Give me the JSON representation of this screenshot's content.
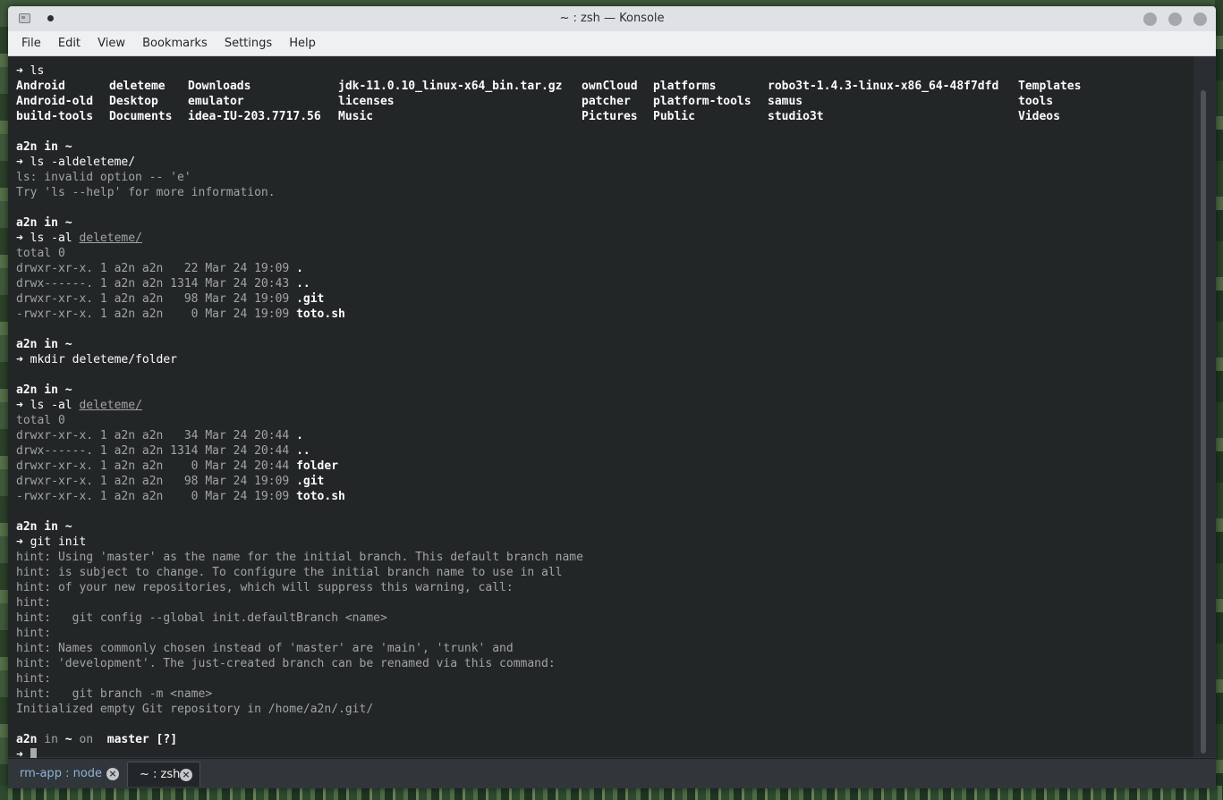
{
  "window": {
    "title": "~ : zsh — Konsole"
  },
  "menu": [
    "File",
    "Edit",
    "View",
    "Bookmarks",
    "Settings",
    "Help"
  ],
  "ls_prompt": "➜ ls",
  "ls_grid": [
    [
      "Android",
      "deleteme",
      "Downloads",
      "jdk-11.0.10_linux-x64_bin.tar.gz",
      "ownCloud",
      "platforms",
      "robo3t-1.4.3-linux-x86_64-48f7dfd",
      "Templates"
    ],
    [
      "Android-old",
      "Desktop",
      "emulator",
      "licenses",
      "patcher",
      "platform-tools",
      "samus",
      "tools"
    ],
    [
      "build-tools",
      "Documents",
      "idea-IU-203.7717.56",
      "Music",
      "Pictures",
      "Public",
      "studio3t",
      "Videos"
    ]
  ],
  "prompt_user": "a2n in ~",
  "cmd_aldeleteme": "➜ ls -aldeleteme/",
  "err1": "ls: invalid option -- 'e'",
  "err2": "Try 'ls --help' for more information.",
  "cmd_ls_al": "➜ ls -al ",
  "deleteme_dir": "deleteme/",
  "total": "total 0",
  "listing1": [
    {
      "meta": "drwxr-xr-x. 1 a2n a2n   22 Mar 24 19:09 ",
      "name": "."
    },
    {
      "meta": "drwx------. 1 a2n a2n 1314 Mar 24 20:43 ",
      "name": ".."
    },
    {
      "meta": "drwxr-xr-x. 1 a2n a2n   98 Mar 24 19:09 ",
      "name": ".git"
    },
    {
      "meta": "-rwxr-xr-x. 1 a2n a2n    0 Mar 24 19:09 ",
      "name": "toto.sh"
    }
  ],
  "cmd_mkdir": "➜ mkdir deleteme/folder",
  "listing2": [
    {
      "meta": "drwxr-xr-x. 1 a2n a2n   34 Mar 24 20:44 ",
      "name": "."
    },
    {
      "meta": "drwx------. 1 a2n a2n 1314 Mar 24 20:44 ",
      "name": ".."
    },
    {
      "meta": "drwxr-xr-x. 1 a2n a2n    0 Mar 24 20:44 ",
      "name": "folder"
    },
    {
      "meta": "drwxr-xr-x. 1 a2n a2n   98 Mar 24 19:09 ",
      "name": ".git"
    },
    {
      "meta": "-rwxr-xr-x. 1 a2n a2n    0 Mar 24 19:09 ",
      "name": "toto.sh"
    }
  ],
  "cmd_git_init": "➜ git init",
  "git_hints": [
    "hint: Using 'master' as the name for the initial branch. This default branch name",
    "hint: is subject to change. To configure the initial branch name to use in all",
    "hint: of your new repositories, which will suppress this warning, call:",
    "hint:",
    "hint:   git config --global init.defaultBranch <name>",
    "hint:",
    "hint: Names commonly chosen instead of 'master' are 'main', 'trunk' and",
    "hint: 'development'. The just-created branch can be renamed via this command:",
    "hint:",
    "hint:   git branch -m <name>",
    "Initialized empty Git repository in /home/a2n/.git/"
  ],
  "final_prompt": {
    "user": "a2n",
    "in": " in ",
    "dir": "~",
    "on": " on ",
    "branch_glyph": "",
    "branch": " master [?]"
  },
  "input_prompt": "➜ ",
  "tabs": [
    {
      "label": "rm-app : node"
    },
    {
      "label": "~ : zsh"
    }
  ]
}
